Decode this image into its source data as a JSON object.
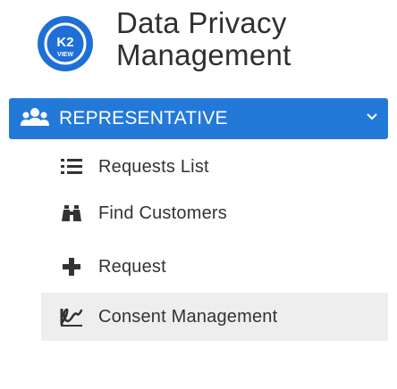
{
  "app": {
    "title_line1": "Data Privacy",
    "title_line2": "Management",
    "logo_text_top": "K2",
    "logo_text_bottom": "VIEW"
  },
  "role_selector": {
    "label": "REPRESENTATIVE",
    "icon": "users-group-icon",
    "chevron": "chevron-down-icon"
  },
  "menu": {
    "items": [
      {
        "label": "Requests List",
        "icon": "list-icon",
        "active": false
      },
      {
        "label": "Find Customers",
        "icon": "binoculars-icon",
        "active": false
      },
      {
        "label": "Request",
        "icon": "plus-icon",
        "active": false
      },
      {
        "label": "Consent Management",
        "icon": "signature-icon",
        "active": true
      }
    ]
  },
  "colors": {
    "accent": "#2379d8",
    "text": "#333333",
    "active_bg": "#eeeeee",
    "logo_blue": "#1e6fd6"
  }
}
